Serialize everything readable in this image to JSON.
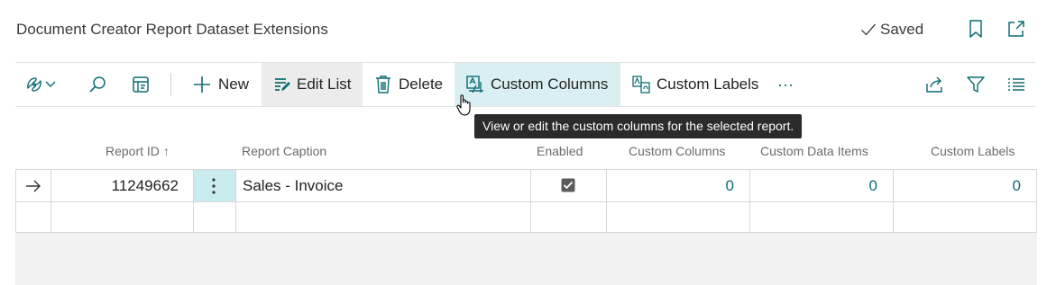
{
  "header": {
    "title": "Document Creator Report Dataset Extensions",
    "saved_label": "Saved",
    "icons": [
      "check-icon",
      "bookmark-icon",
      "open-in-new-window-icon"
    ]
  },
  "toolbar": {
    "icons_left": [
      "copilot-icon",
      "chevron-down-icon",
      "search-icon",
      "filter-pane-icon"
    ],
    "new_label": "New",
    "edit_list_label": "Edit List",
    "delete_label": "Delete",
    "custom_columns_label": "Custom Columns",
    "custom_labels_label": "Custom Labels",
    "more_label": "···",
    "icons_right": [
      "share-icon",
      "filter-icon",
      "list-view-icon"
    ]
  },
  "tooltip": "View or edit the custom columns for the selected report.",
  "table": {
    "columns": [
      "Report ID",
      "Report Caption",
      "Enabled",
      "Custom Columns",
      "Custom Data Items",
      "Custom Labels"
    ],
    "sort_indicator": "↑",
    "rows": [
      {
        "report_id": "11249662",
        "report_caption": "Sales - Invoice",
        "enabled": true,
        "custom_columns": "0",
        "custom_data_items": "0",
        "custom_labels": "0"
      }
    ]
  }
}
